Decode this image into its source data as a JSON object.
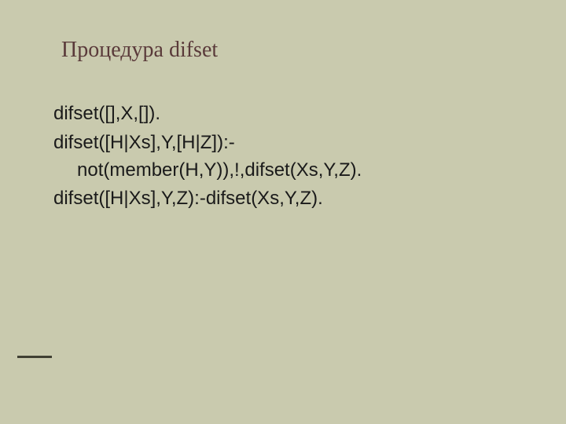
{
  "title": "Процедура difset",
  "lines": {
    "l1": "difset([],X,[]).",
    "l2": "difset([H|Xs],Y,[H|Z]):-not(member(H,Y)),!,difset(Xs,Y,Z).",
    "l3": "difset([H|Xs],Y,Z):-difset(Xs,Y,Z)."
  }
}
